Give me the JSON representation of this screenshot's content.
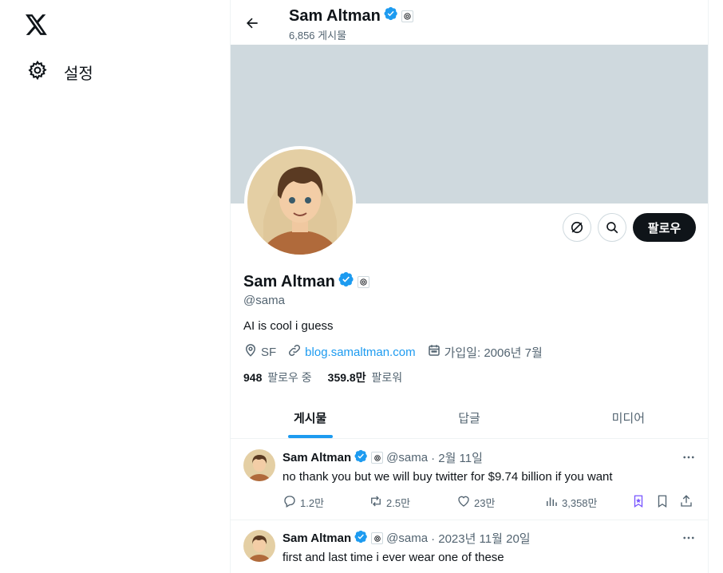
{
  "nav": {
    "settings_label": "설정"
  },
  "header": {
    "name": "Sam Altman",
    "post_count": "6,856 게시물"
  },
  "profile": {
    "name": "Sam Altman",
    "handle": "@sama",
    "bio": "AI is cool i guess",
    "location": "SF",
    "website": "blog.samaltman.com",
    "joined": "가입일: 2006년 7월",
    "following_count": "948",
    "following_label": "팔로우 중",
    "followers_count": "359.8만",
    "followers_label": "팔로워",
    "follow_button": "팔로우"
  },
  "tabs": [
    {
      "label": "게시물",
      "active": true
    },
    {
      "label": "답글",
      "active": false
    },
    {
      "label": "미디어",
      "active": false
    }
  ],
  "tweets": [
    {
      "name": "Sam Altman",
      "handle": "@sama",
      "date": "· 2월 11일",
      "text": "no thank you but we will buy twitter for $9.74 billion if you want",
      "replies": "1.2만",
      "retweets": "2.5만",
      "likes": "23만",
      "views": "3,358만"
    },
    {
      "name": "Sam Altman",
      "handle": "@sama",
      "date": "· 2023년 11월 20일",
      "text": "first and last time i ever wear one of these"
    }
  ],
  "colors": {
    "accent": "#1d9bf0",
    "banner": "#cfd9de",
    "text_primary": "#0f1419",
    "text_secondary": "#536471",
    "follow_button_bg": "#0f1419"
  },
  "icons": [
    "x-logo-icon",
    "gear-icon",
    "back-arrow-icon",
    "verified-badge-icon",
    "openai-affiliate-icon",
    "subscribe-icon",
    "search-icon",
    "location-icon",
    "link-icon",
    "calendar-icon",
    "more-icon",
    "reply-icon",
    "retweet-icon",
    "like-icon",
    "views-icon",
    "grok-icon",
    "bookmark-icon",
    "share-icon"
  ]
}
